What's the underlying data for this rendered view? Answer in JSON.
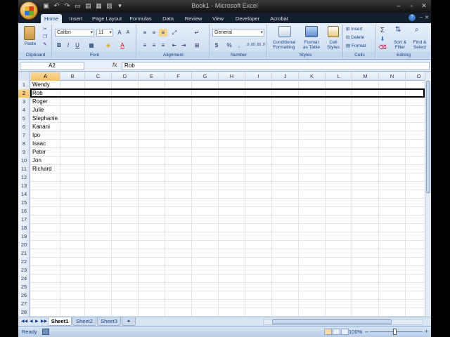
{
  "window": {
    "title": "Book1 - Microsoft Excel"
  },
  "ribbon": {
    "tabs": [
      "Home",
      "Insert",
      "Page Layout",
      "Formulas",
      "Data",
      "Review",
      "Developer",
      "Acrobat"
    ],
    "active_tab": "Home",
    "clipboard": {
      "label": "Clipboard",
      "paste": "Paste"
    },
    "font": {
      "label": "Font",
      "name": "Calibri",
      "size": "11"
    },
    "alignment": {
      "label": "Alignment"
    },
    "number": {
      "label": "Number",
      "format": "General",
      "currency": "$",
      "percent": "%",
      "comma": ",",
      "inc_decimal": ".0 .00",
      "dec_decimal": ".00 .0"
    },
    "styles": {
      "label": "Styles",
      "conditional_1": "Conditional",
      "conditional_2": "Formatting",
      "format_table_1": "Format",
      "format_table_2": "as Table",
      "cell_styles_1": "Cell",
      "cell_styles_2": "Styles"
    },
    "cells": {
      "label": "Cells",
      "insert": "Insert",
      "delete": "Delete",
      "format": "Format"
    },
    "editing": {
      "label": "Editing",
      "sort_1": "Sort &",
      "sort_2": "Filter",
      "find_1": "Find &",
      "find_2": "Select"
    }
  },
  "formula_bar": {
    "name_box": "A2",
    "fx": "fx",
    "value": "Rob"
  },
  "grid": {
    "columns": [
      "A",
      "B",
      "C",
      "D",
      "E",
      "F",
      "G",
      "H",
      "I",
      "J",
      "K",
      "L",
      "M",
      "N",
      "O"
    ],
    "selected_column": "A",
    "selected_row": 2,
    "rows": [
      {
        "num": "1",
        "a": "Wendy"
      },
      {
        "num": "2",
        "a": "Rob"
      },
      {
        "num": "3",
        "a": "Roger"
      },
      {
        "num": "4",
        "a": "Julie"
      },
      {
        "num": "5",
        "a": "Stephanie"
      },
      {
        "num": "6",
        "a": "Kanani"
      },
      {
        "num": "7",
        "a": "Ipo"
      },
      {
        "num": "8",
        "a": "Isaac"
      },
      {
        "num": "9",
        "a": "Peter"
      },
      {
        "num": "10",
        "a": "Jon"
      },
      {
        "num": "11",
        "a": "Richard"
      },
      {
        "num": "12",
        "a": ""
      },
      {
        "num": "13",
        "a": ""
      },
      {
        "num": "14",
        "a": ""
      },
      {
        "num": "15",
        "a": ""
      },
      {
        "num": "16",
        "a": ""
      },
      {
        "num": "17",
        "a": ""
      },
      {
        "num": "18",
        "a": ""
      },
      {
        "num": "19",
        "a": ""
      },
      {
        "num": "20",
        "a": ""
      },
      {
        "num": "21",
        "a": ""
      },
      {
        "num": "22",
        "a": ""
      },
      {
        "num": "23",
        "a": ""
      },
      {
        "num": "24",
        "a": ""
      },
      {
        "num": "25",
        "a": ""
      },
      {
        "num": "26",
        "a": ""
      },
      {
        "num": "27",
        "a": ""
      },
      {
        "num": "28",
        "a": ""
      }
    ]
  },
  "sheets": [
    "Sheet1",
    "Sheet2",
    "Sheet3"
  ],
  "active_sheet": "Sheet1",
  "status": {
    "text": "Ready",
    "zoom": "100%"
  }
}
